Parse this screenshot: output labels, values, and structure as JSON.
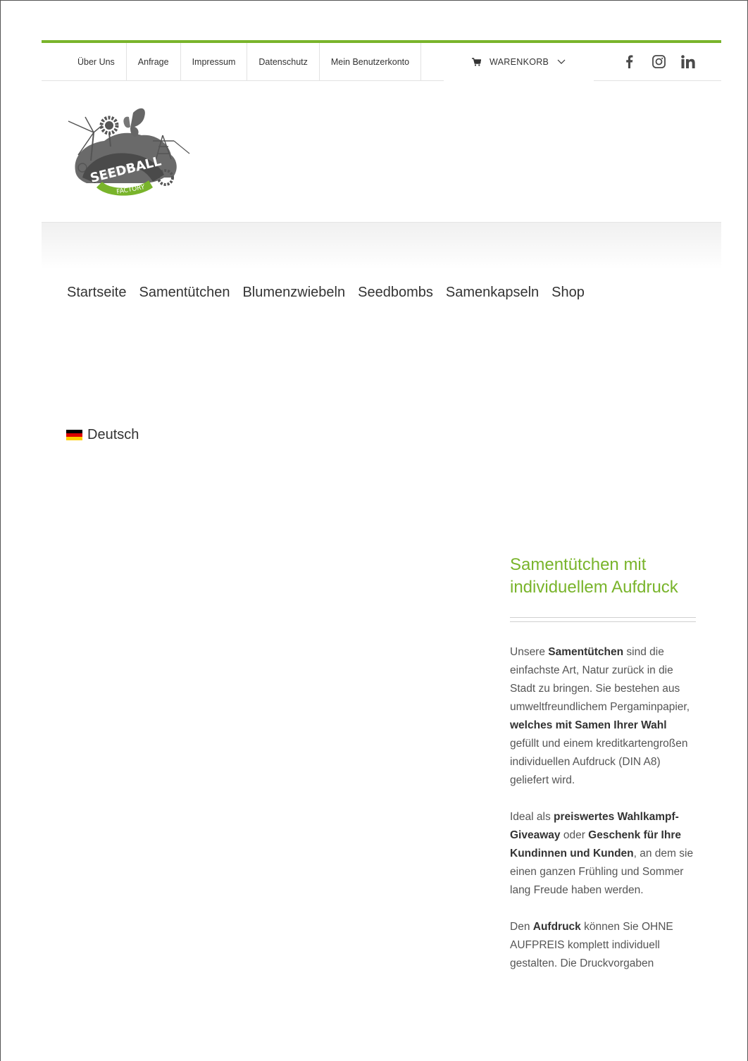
{
  "colors": {
    "accent": "#79b42b",
    "text": "#333333"
  },
  "top_menu": [
    "Über Uns",
    "Anfrage",
    "Impressum",
    "Datenschutz",
    "Mein Benutzerkonto"
  ],
  "cart": {
    "label": "WARENKORB",
    "icon": "shopping-cart-icon"
  },
  "social": [
    "facebook-icon",
    "instagram-icon",
    "linkedin-icon"
  ],
  "logo": {
    "text_main": "SEEDBALL",
    "text_sub": "FACTORY"
  },
  "main_nav": [
    "Startseite",
    "Samentütchen",
    "Blumenzwiebeln",
    "Seedbombs",
    "Samenkapseln",
    "Shop"
  ],
  "language": {
    "label": "Deutsch",
    "icon": "german-flag-icon"
  },
  "sidebar": {
    "title": "Samentütchen mit individuellem Aufdruck",
    "p1": {
      "a": "Unsere ",
      "b": "Samentütchen",
      "c": " sind die einfachste Art, Natur zurück in die Stadt zu bringen. Sie bestehen aus umweltfreundlichem Pergaminpapier, ",
      "d": "welches mit Samen Ihrer Wahl",
      "e": " gefüllt und einem kreditkartengroßen individuellen Aufdruck (DIN A8) geliefert wird."
    },
    "p2": {
      "a": "Ideal als ",
      "b": "preiswertes Wahlkampf-Giveaway",
      "c": " oder ",
      "d": "Geschenk für Ihre Kundinnen und Kunden",
      "e": ", an dem sie einen ganzen Frühling und Sommer lang Freude haben werden."
    },
    "p3": {
      "a": "Den ",
      "b": "Aufdruck",
      "c": " können Sie OHNE AUFPREIS komplett individuell gestalten. Die Druckvorgaben"
    }
  }
}
